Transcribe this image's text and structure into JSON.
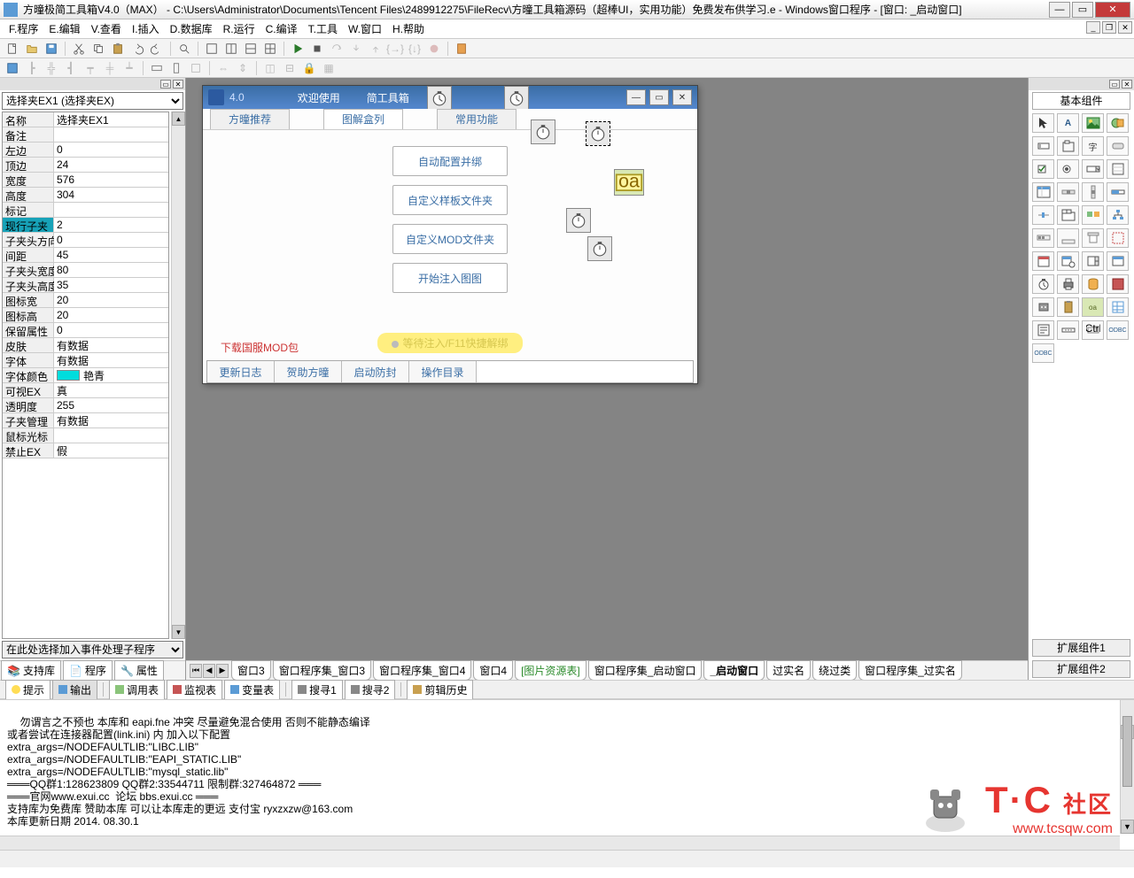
{
  "window": {
    "title": "方曈极简工具箱V4.0（MAX）  -  C:\\Users\\Administrator\\Documents\\Tencent Files\\2489912275\\FileRecv\\方曈工具箱源码（超棒UI，实用功能）免费发布供学习.e - Windows窗口程序 - [窗口: _启动窗口]"
  },
  "menu": {
    "items": [
      "F.程序",
      "E.编辑",
      "V.查看",
      "I.插入",
      "D.数据库",
      "R.运行",
      "C.编译",
      "T.工具",
      "W.窗口",
      "H.帮助"
    ]
  },
  "left": {
    "combo": "选择夹EX1 (选择夹EX)",
    "props": [
      {
        "n": "名称",
        "v": "选择夹EX1"
      },
      {
        "n": "备注",
        "v": ""
      },
      {
        "n": "左边",
        "v": "0"
      },
      {
        "n": "顶边",
        "v": "24"
      },
      {
        "n": "宽度",
        "v": "576"
      },
      {
        "n": "高度",
        "v": "304"
      },
      {
        "n": "标记",
        "v": ""
      },
      {
        "n": "现行子夹",
        "v": "2",
        "hl": true
      },
      {
        "n": "子夹头方向",
        "v": "0"
      },
      {
        "n": "间距",
        "v": "45"
      },
      {
        "n": "子夹头宽度",
        "v": "80"
      },
      {
        "n": "子夹头高度",
        "v": "35"
      },
      {
        "n": "图标宽",
        "v": "20"
      },
      {
        "n": "图标高",
        "v": "20"
      },
      {
        "n": "保留属性",
        "v": "0"
      },
      {
        "n": "皮肤",
        "v": "有数据"
      },
      {
        "n": "字体",
        "v": "有数据"
      },
      {
        "n": "字体颜色",
        "v": "艳青",
        "color": true
      },
      {
        "n": "可视EX",
        "v": "真"
      },
      {
        "n": "透明度",
        "v": "255"
      },
      {
        "n": "子夹管理",
        "v": "有数据"
      },
      {
        "n": "鼠标光标",
        "v": ""
      },
      {
        "n": "禁止EX",
        "v": "假"
      }
    ],
    "event_combo": "在此处选择加入事件处理子程序",
    "tools": [
      "支持库",
      "程序",
      "属性"
    ]
  },
  "designer": {
    "title_left": "4.0",
    "title_welcome": "欢迎使用",
    "title_right": "简工具箱",
    "tabs": [
      "方曈推荐",
      "图解盒列",
      "常用功能"
    ],
    "center_buttons": [
      "自动配置并绑",
      "自定义样板文件夹",
      "自定义MOD文件夹",
      "开始注入图图"
    ],
    "status": "等待注入/F11快捷解绑",
    "link": "下载国服MOD包",
    "bottom_tabs": [
      "更新日志",
      "贺助方曈",
      "启动防封",
      "操作目录"
    ]
  },
  "doc_tabs": [
    "窗口3",
    "窗口程序集_窗口3",
    "窗口程序集_窗口4",
    "窗口4",
    "[图片资源表]",
    "窗口程序集_启动窗口",
    "_启动窗口",
    "过实名",
    "绕过类",
    "窗口程序集_过实名"
  ],
  "bottom_panel": {
    "items": [
      "提示",
      "输出",
      "调用表",
      "监视表",
      "变量表",
      "搜寻1",
      "搜寻2",
      "剪辑历史"
    ]
  },
  "output_text": "勿谓言之不预也 本库和 eapi.fne 冲突 尽量避免混合使用 否则不能静态编译\n或者尝试在连接器配置(link.ini) 内 加入以下配置\nextra_args=/NODEFAULTLIB:\"LIBC.LIB\"\nextra_args=/NODEFAULTLIB:\"EAPI_STATIC.LIB\"\nextra_args=/NODEFAULTLIB:\"mysql_static.lib\"\n═══QQ群1:128623809 QQ群2:33544711 限制群:327464872 ═══\n═══官网www.exui.cc  论坛 bbs.exui.cc ═══\n支持库为免费库 赞助本库 可以让本库走的更远 支付宝 ryxzxzw@163.com\n本库更新日期 2014. 08.30.1",
  "right": {
    "header": "基本组件",
    "footer1": "扩展组件1",
    "footer2": "扩展组件2"
  },
  "watermark": {
    "tc": "T·C",
    "sq": "社区",
    "url": "www.tcsqw.com"
  }
}
